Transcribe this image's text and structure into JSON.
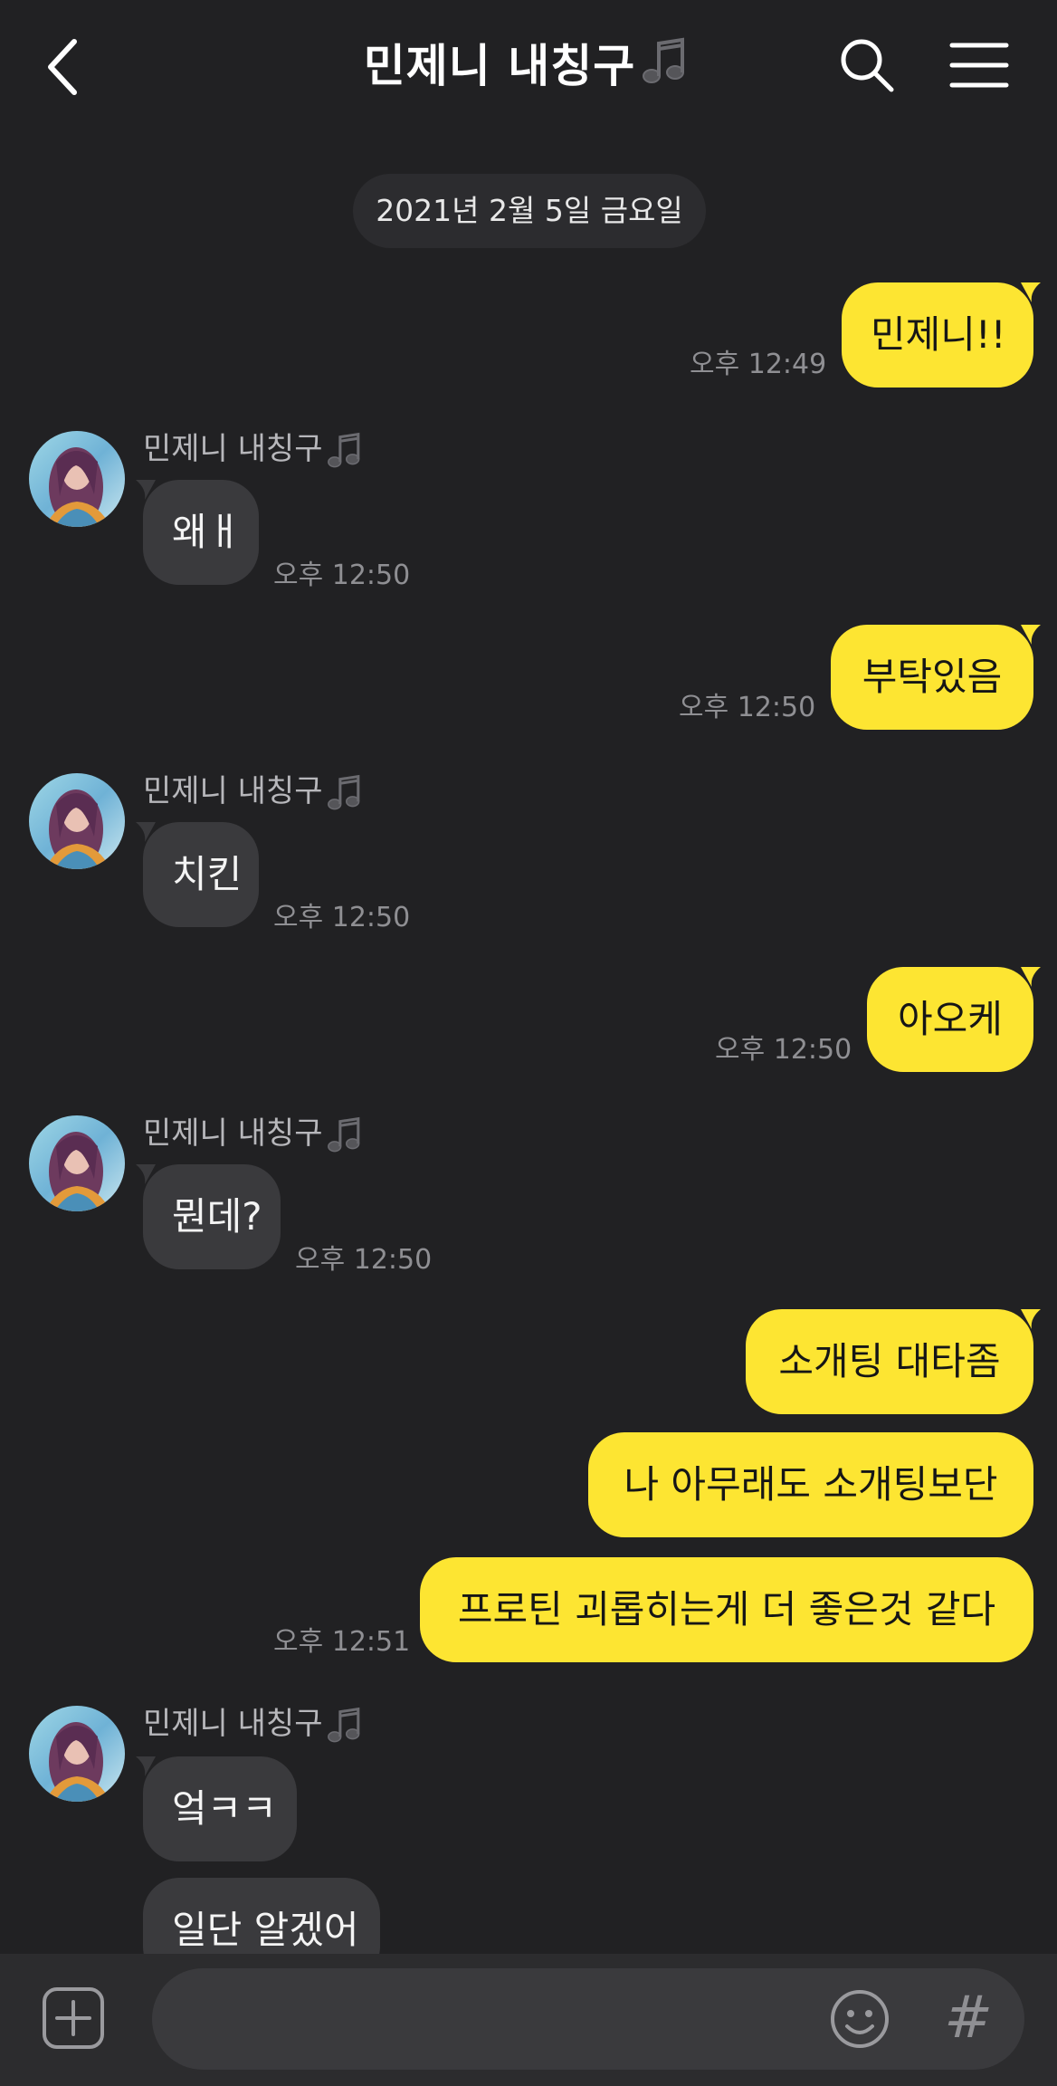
{
  "header": {
    "title": "민제니 내칭구",
    "back_icon": "chevron-left-icon",
    "search_icon": "search-icon",
    "menu_icon": "hamburger-menu-icon"
  },
  "date_divider": "2021년 2월 5일 금요일",
  "friend": {
    "name": "민제니 내칭구"
  },
  "messages": [
    {
      "side": "me",
      "text": "민제니!!",
      "time": "오후 12:49"
    },
    {
      "side": "them",
      "text": "왜ㅐ",
      "time": "오후 12:50"
    },
    {
      "side": "me",
      "text": "부탁있음",
      "time": "오후 12:50"
    },
    {
      "side": "them",
      "text": "치킨",
      "time": "오후 12:50"
    },
    {
      "side": "me",
      "text": "아오케",
      "time": "오후 12:50"
    },
    {
      "side": "them",
      "text": "뭔데?",
      "time": "오후 12:50"
    },
    {
      "side": "me",
      "text": "소개팅 대타좀"
    },
    {
      "side": "me",
      "text": "나 아무래도 소개팅보단"
    },
    {
      "side": "me",
      "text": "프로틴 괴롭히는게 더 좋은것 같다",
      "time": "오후 12:51"
    },
    {
      "side": "them",
      "text": "엌ㅋㅋ"
    },
    {
      "side": "them",
      "text": "일단 알겠어"
    }
  ],
  "input_bar": {
    "plus_icon": "plus-square-icon",
    "emoji_icon": "smiley-icon",
    "hash_label": "#"
  },
  "colors": {
    "background": "#212123",
    "my_bubble": "#fde532",
    "their_bubble": "#3a3a3d",
    "time_text": "#8f8f93"
  }
}
